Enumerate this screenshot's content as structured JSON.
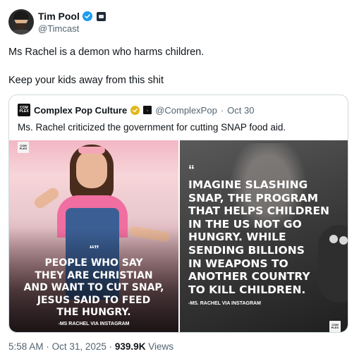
{
  "author": {
    "display_name": "Tim Pool",
    "handle": "@Timcast"
  },
  "post": {
    "line1": "Ms Rachel is a demon who harms children.",
    "line2": "Keep your kids away from this shit"
  },
  "quoted": {
    "display_name": "Complex Pop Culture",
    "handle": "@ComplexPop",
    "separator": "·",
    "date": "Oct 30",
    "text": "Ms. Rachel criticized the government for cutting SNAP food aid.",
    "logo_text": "COM PLEX",
    "left_image": {
      "quote_mark": "“”",
      "caption_lines": [
        "PEOPLE WHO SAY",
        "THEY ARE CHRISTIAN",
        "AND WANT TO CUT SNAP,",
        "JESUS SAID TO FEED",
        "THE HUNGRY."
      ],
      "attribution": "-MS RACHEL VIA INSTAGRAM"
    },
    "right_image": {
      "quote_mark": "“",
      "caption_lines": [
        "IMAGINE SLASHING",
        "SNAP, THE PROGRAM",
        "THAT HELPS CHILDREN",
        "IN THE US NOT GO",
        "HUNGRY. WHILE",
        "SENDING BILLIONS",
        "IN WEAPONS TO",
        "ANOTHER COUNTRY",
        "TO KILL CHILDREN."
      ],
      "attribution": "-MS. RACHEL VIA INSTAGRAM"
    }
  },
  "meta": {
    "time": "5:58 AM",
    "date": "Oct 31, 2025",
    "separator": "·",
    "views_count": "939.9K",
    "views_label": "Views"
  },
  "colors": {
    "verified_blue": "#1d9bf0",
    "verified_gold": "#e2b719",
    "secondary_text": "#536471",
    "border": "#cfd9de"
  },
  "icons": {
    "verified": "verified-badge-icon",
    "gold_verified": "gold-verified-badge-icon",
    "affiliation": "affiliation-badge-icon"
  }
}
